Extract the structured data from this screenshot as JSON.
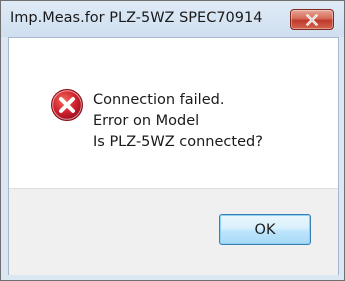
{
  "dialog": {
    "title": "Imp.Meas.for PLZ-5WZ SPEC70914",
    "icon": "error-icon",
    "message_lines": [
      "Connection failed.",
      "Error on Model",
      "Is PLZ-5WZ connected?"
    ],
    "ok_label": "OK",
    "close_icon": "close-icon"
  },
  "colors": {
    "close_button": "#c0392b",
    "error_icon": "#c8102e",
    "ok_button_border": "#3c7fb1",
    "footer_bg": "#f0f0f0",
    "titlebar_bg": "#dbe7f3"
  }
}
